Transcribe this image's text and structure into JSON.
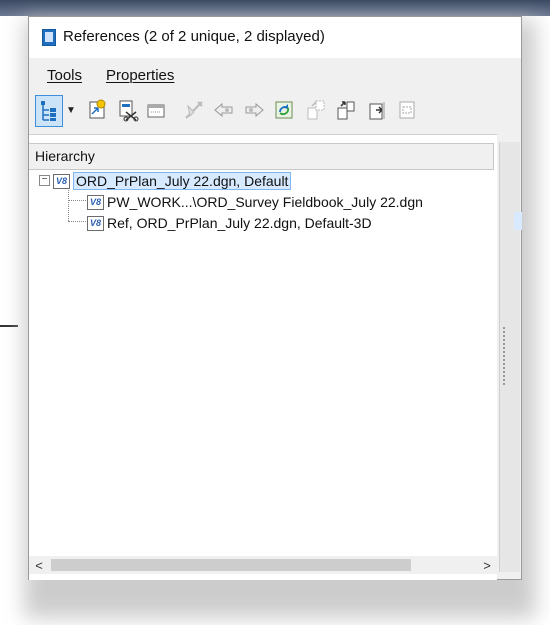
{
  "window": {
    "title": "References (2 of 2 unique, 2 displayed)"
  },
  "menubar": {
    "items": [
      "Tools",
      "Properties"
    ]
  },
  "toolbar": {
    "buttons": [
      {
        "icon": "hierarchy-tree-icon",
        "active": true
      },
      {
        "icon": "attach-reference-icon"
      },
      {
        "icon": "detach-reference-icon"
      },
      {
        "icon": "reload-reference-icon"
      },
      {
        "icon": "exchange-reference-icon"
      },
      {
        "icon": "move-reference-icon"
      },
      {
        "icon": "copy-reference-icon"
      },
      {
        "icon": "rotate-reference-icon"
      },
      {
        "icon": "scale-reference-icon"
      },
      {
        "icon": "mirror-horizontal-icon"
      },
      {
        "icon": "mirror-vertical-icon"
      },
      {
        "icon": "clip-boundary-icon"
      }
    ]
  },
  "hierarchy": {
    "header": "Hierarchy",
    "root": {
      "label": "ORD_PrPlan_July 22.dgn, Default",
      "icon": "v8-file-icon",
      "expanded": true,
      "children": [
        {
          "label": "PW_WORK...\\ORD_Survey Fieldbook_July 22.dgn",
          "icon": "v8-file-icon"
        },
        {
          "label": "Ref, ORD_PrPlan_July 22.dgn, Default-3D",
          "icon": "v8-file-icon"
        }
      ]
    },
    "expander_glyph": "−",
    "icon_text": "V8"
  },
  "scrollbar": {
    "left_arrow": "<",
    "right_arrow": ">"
  },
  "colors": {
    "selection_fill": "#d7eaff",
    "selection_border": "#7fb7ee",
    "active_button": "#cce4f7",
    "accent_blue": "#1f6fc0"
  }
}
